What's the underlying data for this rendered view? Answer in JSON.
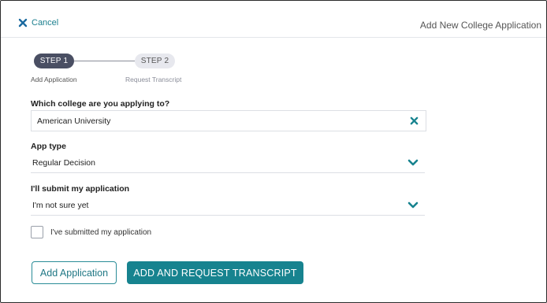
{
  "topbar": {
    "cancel_label": "Cancel",
    "title": "Add New College Application"
  },
  "stepper": {
    "steps": [
      {
        "pill": "STEP 1",
        "caption": "Add Application",
        "active": true
      },
      {
        "pill": "STEP 2",
        "caption": "Request Transcript",
        "active": false
      }
    ]
  },
  "form": {
    "college": {
      "label": "Which college are you applying to?",
      "value": "American University",
      "clear_icon": "close-icon"
    },
    "app_type": {
      "label": "App type",
      "value": "Regular Decision",
      "dropdown_icon": "chevron-down-icon"
    },
    "submit_timing": {
      "label": "I'll submit my application",
      "value": "I'm not sure yet",
      "dropdown_icon": "chevron-down-icon"
    },
    "submitted_checkbox": {
      "label": "I've submitted my application",
      "checked": false
    }
  },
  "actions": {
    "add_label": "Add Application",
    "add_and_request_label": "ADD AND REQUEST TRANSCRIPT"
  },
  "colors": {
    "accent": "#17838f",
    "step_active": "#4a4f63",
    "step_inactive": "#e7e8ee"
  }
}
